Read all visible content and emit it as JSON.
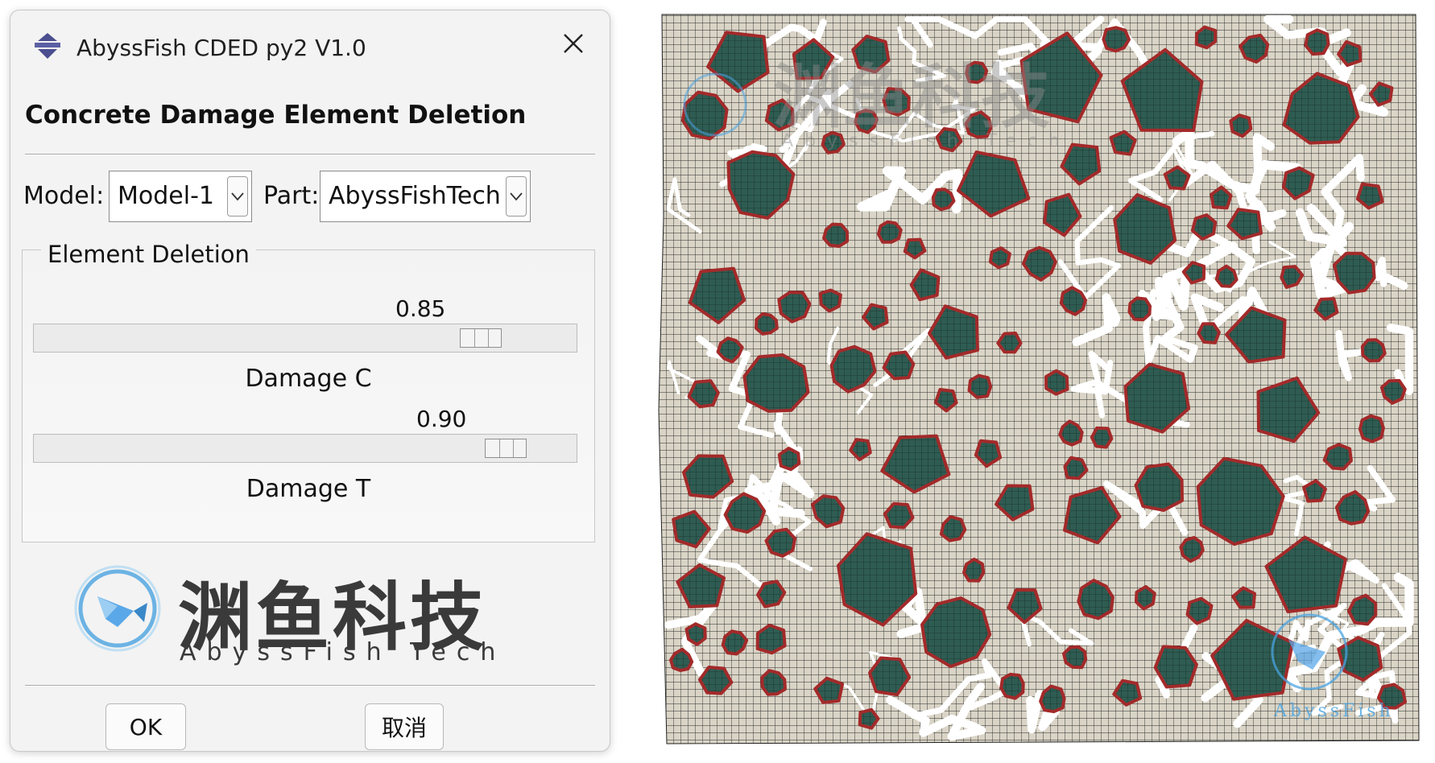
{
  "dialog": {
    "title": "AbyssFish CDED py2 V1.0",
    "heading": "Concrete Damage Element Deletion",
    "model_label": "Model:",
    "model_value": "Model-1",
    "part_label": "Part:",
    "part_value": "AbyssFishTech",
    "group_title": "Element Deletion",
    "sliders": [
      {
        "caption": "Damage C",
        "value_text": "0.85",
        "value": 0.85
      },
      {
        "caption": "Damage T",
        "value_text": "0.90",
        "value": 0.9
      }
    ],
    "logo_cn": "渊鱼科技",
    "logo_en": "AbyssFish Tech",
    "ok_label": "OK",
    "cancel_label": "取消"
  },
  "mesh_view": {
    "watermark_cn": "渊鱼科技",
    "watermark_en": "AbyssFish Tech",
    "corner_watermark": "AbyssFish",
    "colors": {
      "matrix": "#d9d4c6",
      "mesh_line": "#2a2a2a",
      "aggregate": "#2f5c52",
      "interface": "#a32a2a",
      "crack": "#ffffff"
    }
  },
  "colors": {
    "dialog_bg": "#f3f3f3",
    "logo_blue": "#4aa3e0"
  }
}
